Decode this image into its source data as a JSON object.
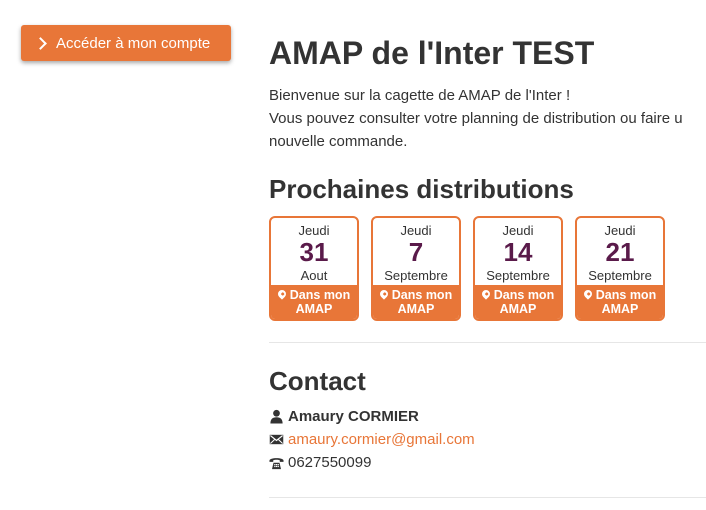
{
  "account_button": {
    "label": "Accéder à mon compte",
    "icon": "chevron-right-icon"
  },
  "title": "AMAP de l'Inter TEST",
  "intro": {
    "line1": "Bienvenue sur la cagette de AMAP de l'Inter !",
    "line2": "Vous pouvez consulter votre planning de distribution ou faire u",
    "line3": "nouvelle commande."
  },
  "distributions": {
    "heading": "Prochaines distributions",
    "items": [
      {
        "day": "Jeudi",
        "date": "31",
        "month": "Aout",
        "place": "Dans mon AMAP"
      },
      {
        "day": "Jeudi",
        "date": "7",
        "month": "Septembre",
        "place": "Dans mon AMAP"
      },
      {
        "day": "Jeudi",
        "date": "14",
        "month": "Septembre",
        "place": "Dans mon AMAP"
      },
      {
        "day": "Jeudi",
        "date": "21",
        "month": "Septembre",
        "place": "Dans mon AMAP"
      }
    ]
  },
  "contact": {
    "heading": "Contact",
    "name": "Amaury CORMIER",
    "email": "amaury.cormier@gmail.com",
    "phone": "0627550099"
  },
  "colors": {
    "accent": "#e87638",
    "date_number": "#5a1a4a",
    "text": "#333333"
  }
}
